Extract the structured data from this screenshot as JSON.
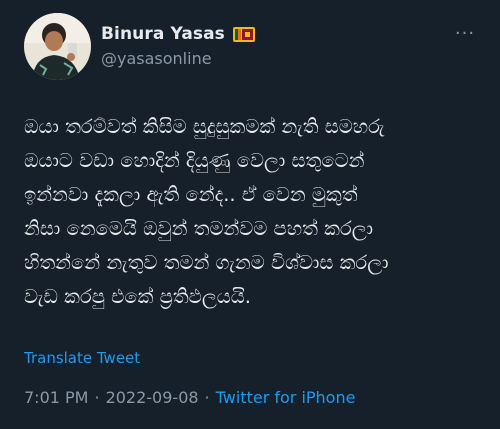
{
  "user": {
    "display_name": "Binura Yasas",
    "handle": "@yasasonline",
    "flag_icon": "sri-lanka-flag-icon"
  },
  "menu_icon": "more-dots-icon",
  "tweet": {
    "lines": [
      "ඔයා තරම්වත් කිසිම සුදුසුකමක් නැති සමහරු",
      "ඔයාට වඩා හොදින් දියුණු වෙලා සතුටෙන්",
      "ඉන්නවා දැකලා ඇති නේද.. ඒ වෙන මුකුත්",
      "නිසා නෙමෙයි ඔවුන් තමන්වම පහත් කරලා",
      "හිතන්නේ නැතුව තමන් ගැනම විශ්වාස කරලා",
      "වැඩ කරපු එකේ ප්‍රතිඵලයයි."
    ]
  },
  "translate_label": "Translate Tweet",
  "meta": {
    "time": "7:01 PM",
    "sep1": "·",
    "date": "2022-09-08",
    "sep2": "·",
    "source": "Twitter for iPhone"
  },
  "colors": {
    "background": "#15202b",
    "accent": "#1d9bf0",
    "secondary_text": "#8b98a5"
  }
}
